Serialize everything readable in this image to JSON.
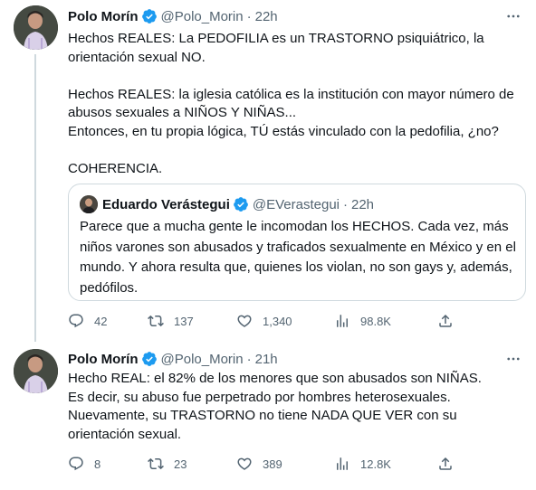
{
  "tweets": [
    {
      "author": {
        "name": "Polo Morín",
        "handle": "@Polo_Morin",
        "time": "22h"
      },
      "lines": [
        "Hechos REALES: La PEDOFILIA es un TRASTORNO psiquiátrico, la orientación sexual NO.",
        "",
        "Hechos REALES: la iglesia católica es la institución con mayor número de abusos sexuales a NIÑOS Y NIÑAS...",
        "Entonces, en tu propia lógica, TÚ estás vinculado con la pedofilia, ¿no?",
        "",
        "COHERENCIA."
      ],
      "quote": {
        "author": {
          "name": "Eduardo Verástegui",
          "handle": "@EVerastegui",
          "time": "22h"
        },
        "text": "Parece que a mucha gente le incomodan los HECHOS. Cada vez, más niños varones son abusados y traficados sexualmente en México y en el mundo. Y ahora resulta que, quienes los violan, no son gays y, además, pedófilos."
      },
      "stats": {
        "replies": "42",
        "retweets": "137",
        "likes": "1,340",
        "views": "98.8K"
      }
    },
    {
      "author": {
        "name": "Polo Morín",
        "handle": "@Polo_Morin",
        "time": "21h"
      },
      "lines": [
        "Hecho REAL:  el 82% de los menores que son abusados son NIÑAS.",
        "Es decir, su abuso fue perpetrado por hombres heterosexuales.",
        "Nuevamente, su TRASTORNO no tiene NADA QUE VER con su orientación sexual."
      ],
      "stats": {
        "replies": "8",
        "retweets": "23",
        "likes": "389",
        "views": "12.8K"
      }
    }
  ],
  "colors": {
    "verified": "#1d9bf0",
    "secondary_text": "#536471",
    "border": "#cfd9de"
  },
  "icons": [
    "verified-badge-icon",
    "more-icon",
    "reply-icon",
    "retweet-icon",
    "like-icon",
    "views-icon",
    "share-icon"
  ]
}
